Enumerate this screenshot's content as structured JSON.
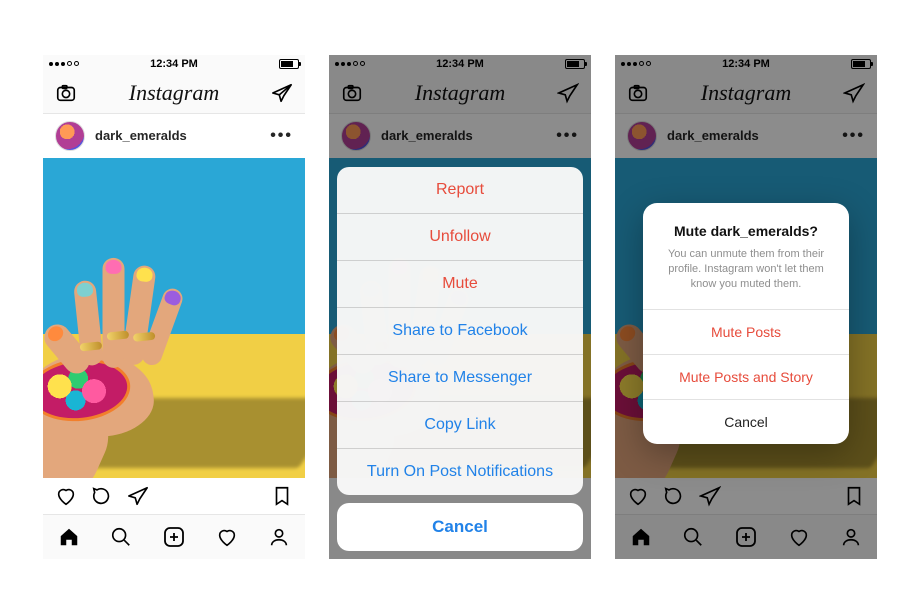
{
  "statusbar": {
    "time": "12:34 PM"
  },
  "header": {
    "logo": "Instagram"
  },
  "post": {
    "username": "dark_emeralds"
  },
  "sheet": {
    "report": "Report",
    "unfollow": "Unfollow",
    "mute": "Mute",
    "share_fb": "Share to Facebook",
    "share_msgr": "Share to Messenger",
    "copy_link": "Copy Link",
    "notifications": "Turn On Post Notifications",
    "cancel": "Cancel"
  },
  "alert": {
    "title": "Mute dark_emeralds?",
    "message": "You can unmute them from their profile. Instagram won't let them know you muted them.",
    "mute_posts": "Mute Posts",
    "mute_posts_story": "Mute Posts and Story",
    "cancel": "Cancel"
  }
}
